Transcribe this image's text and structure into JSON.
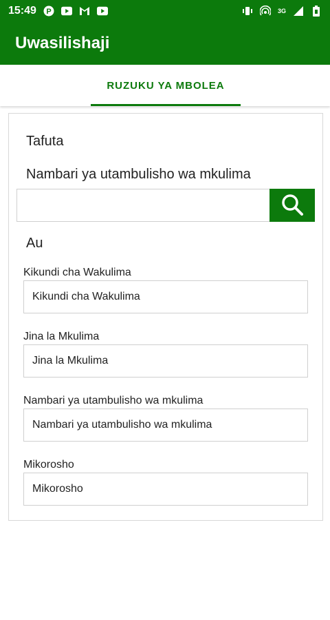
{
  "status_bar": {
    "time": "15:49",
    "network": "3G",
    "left_icons": [
      "parking-icon",
      "youtube-icon",
      "gmail-icon",
      "youtube-icon"
    ],
    "right_icons": [
      "vibrate-icon",
      "hotspot-icon",
      "signal-icon",
      "battery-icon"
    ]
  },
  "app_bar": {
    "title": "Uwasilishaji"
  },
  "tabs": [
    {
      "label": "RUZUKU YA MBOLEA",
      "active": true
    }
  ],
  "search": {
    "heading": "Tafuta",
    "subheading": "Nambari ya utambulisho wa mkulima",
    "value": "",
    "or_label": "Au"
  },
  "fields": [
    {
      "label": "Kikundi cha Wakulima",
      "placeholder": "Kikundi cha Wakulima"
    },
    {
      "label": "Jina la Mkulima",
      "placeholder": "Jina la Mkulima"
    },
    {
      "label": "Nambari ya utambulisho wa mkulima",
      "placeholder": "Nambari ya utambulisho wa mkulima"
    },
    {
      "label": "Mikorosho",
      "placeholder": "Mikorosho"
    }
  ],
  "colors": {
    "primary": "#0c7a0c",
    "border": "#cfcfcf"
  }
}
